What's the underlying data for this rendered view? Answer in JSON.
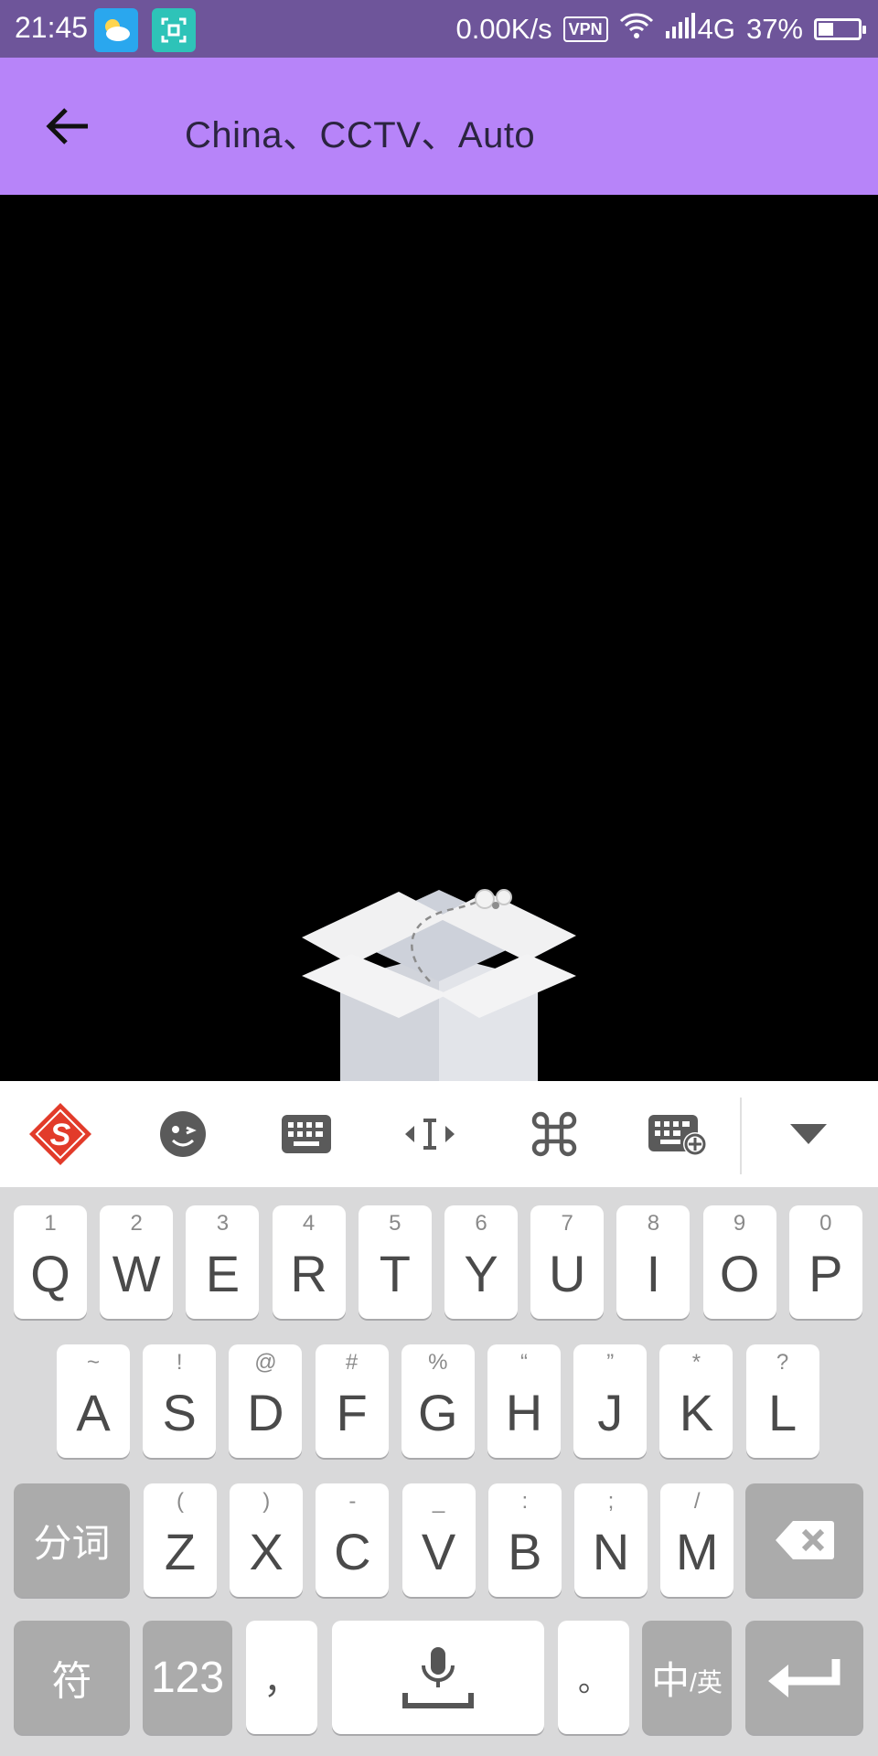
{
  "status_bar": {
    "time": "21:45",
    "speed": "0.00K/s",
    "vpn": "VPN",
    "network": "4G",
    "battery": "37%",
    "battery_level": 0.37,
    "icons": [
      "weather-app-icon",
      "screenshot-scan-icon",
      "wifi-icon",
      "signal-icon",
      "battery-icon"
    ]
  },
  "app_bar": {
    "title": "China、CCTV、Auto",
    "back_icon": "arrow-left-icon"
  },
  "content": {
    "illustration": "empty-box-icon"
  },
  "keyboard_toolbar": {
    "items": [
      "sogou-logo-icon",
      "emoji-icon",
      "keyboard-icon",
      "cursor-move-icon",
      "command-icon",
      "keyboard-settings-icon",
      "collapse-keyboard-icon"
    ]
  },
  "keyboard": {
    "row1": [
      {
        "hint": "1",
        "label": "Q"
      },
      {
        "hint": "2",
        "label": "W"
      },
      {
        "hint": "3",
        "label": "E"
      },
      {
        "hint": "4",
        "label": "R"
      },
      {
        "hint": "5",
        "label": "T"
      },
      {
        "hint": "6",
        "label": "Y"
      },
      {
        "hint": "7",
        "label": "U"
      },
      {
        "hint": "8",
        "label": "I"
      },
      {
        "hint": "9",
        "label": "O"
      },
      {
        "hint": "0",
        "label": "P"
      }
    ],
    "row2": [
      {
        "hint": "~",
        "label": "A"
      },
      {
        "hint": "!",
        "label": "S"
      },
      {
        "hint": "@",
        "label": "D"
      },
      {
        "hint": "#",
        "label": "F"
      },
      {
        "hint": "%",
        "label": "G"
      },
      {
        "hint": "“",
        "label": "H"
      },
      {
        "hint": "”",
        "label": "J"
      },
      {
        "hint": "*",
        "label": "K"
      },
      {
        "hint": "?",
        "label": "L"
      }
    ],
    "row3": [
      {
        "hint": "(",
        "label": "Z"
      },
      {
        "hint": ")",
        "label": "X"
      },
      {
        "hint": "-",
        "label": "C"
      },
      {
        "hint": "_",
        "label": "V"
      },
      {
        "hint": ":",
        "label": "B"
      },
      {
        "hint": ";",
        "label": "N"
      },
      {
        "hint": "/",
        "label": "M"
      }
    ],
    "fenci": "分词",
    "fu": "符",
    "num": "123",
    "comma": "，",
    "period": "。",
    "lang_main": "中",
    "lang_sub": "/英",
    "backspace_icon": "backspace-icon",
    "mic_icon": "microphone-icon",
    "enter_icon": "enter-icon"
  }
}
